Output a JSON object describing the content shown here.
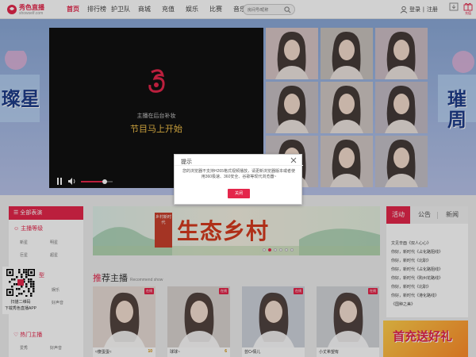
{
  "header": {
    "logo_text": "秀色直播",
    "logo_sub": "showself.com",
    "nav": [
      {
        "label": "首页",
        "active": true
      },
      {
        "label": "排行榜",
        "active": false
      },
      {
        "label": "护卫队",
        "active": false
      },
      {
        "label": "商城",
        "active": false
      },
      {
        "label": "充值",
        "active": false
      },
      {
        "label": "娱乐",
        "active": false
      },
      {
        "label": "比赛",
        "active": false
      },
      {
        "label": "音乐",
        "active": false
      }
    ],
    "search_placeholder": "房间号/昵称",
    "login": "登录",
    "register": "注册",
    "right_label": "充值"
  },
  "hero": {
    "left_art": "璨星",
    "right_art": "璀周",
    "player_msg1": "主播在后台补妆",
    "player_msg2": "节目马上开始",
    "volume_level": 0.75
  },
  "sidebar": {
    "head": "全部表演",
    "section1": "主播等级",
    "grid1": [
      "新星",
      "明星",
      "巨星",
      "超星"
    ],
    "section2_partial": "型",
    "grid2": [
      "娱乐",
      "好声音"
    ],
    "section3": "热门主播",
    "grid3": [
      "爱秀",
      "好声音"
    ]
  },
  "qr": {
    "line1": "扫描二维码",
    "line2": "下载秀色直播APP"
  },
  "banner": {
    "title": "生态乡村",
    "tag": "乡村新时代"
  },
  "recommend": {
    "title_prefix": "推",
    "title_rest": "荐主播",
    "subtitle": "Recommend show",
    "cards": [
      {
        "name": "≈傻蛋蛋≈",
        "level": "10",
        "badge": "在线"
      },
      {
        "name": "球球~",
        "level": "6",
        "badge": "在线"
      },
      {
        "name": "芸C•情儿",
        "level": "",
        "badge": "在线"
      },
      {
        "name": "小丈希望有",
        "level": "",
        "badge": "在线"
      }
    ]
  },
  "right_panel": {
    "tabs": [
      "活动",
      "公告",
      "新闻"
    ],
    "news": [
      "文见辛酉《双人心心》",
      "你好，新时代《占化路阻线》",
      "你好，新时代《北职》",
      "你好，新时代《占化路阻线》",
      "你好，新时代《购州花路线》",
      "你好，新时代《北职》",
      "你好，新时代《港化路线》",
      "《国种之美》"
    ],
    "ad_text": "首充送好礼"
  },
  "dialog": {
    "title": "提示",
    "message": "您的浏览器不支持H265格式视频播放，请更新浏览器版本或者使用360极速、360安全、谷歌等现代浏览器~",
    "button": "关闭"
  },
  "colors": {
    "accent": "#e4264b",
    "gold": "#f5c34a"
  }
}
